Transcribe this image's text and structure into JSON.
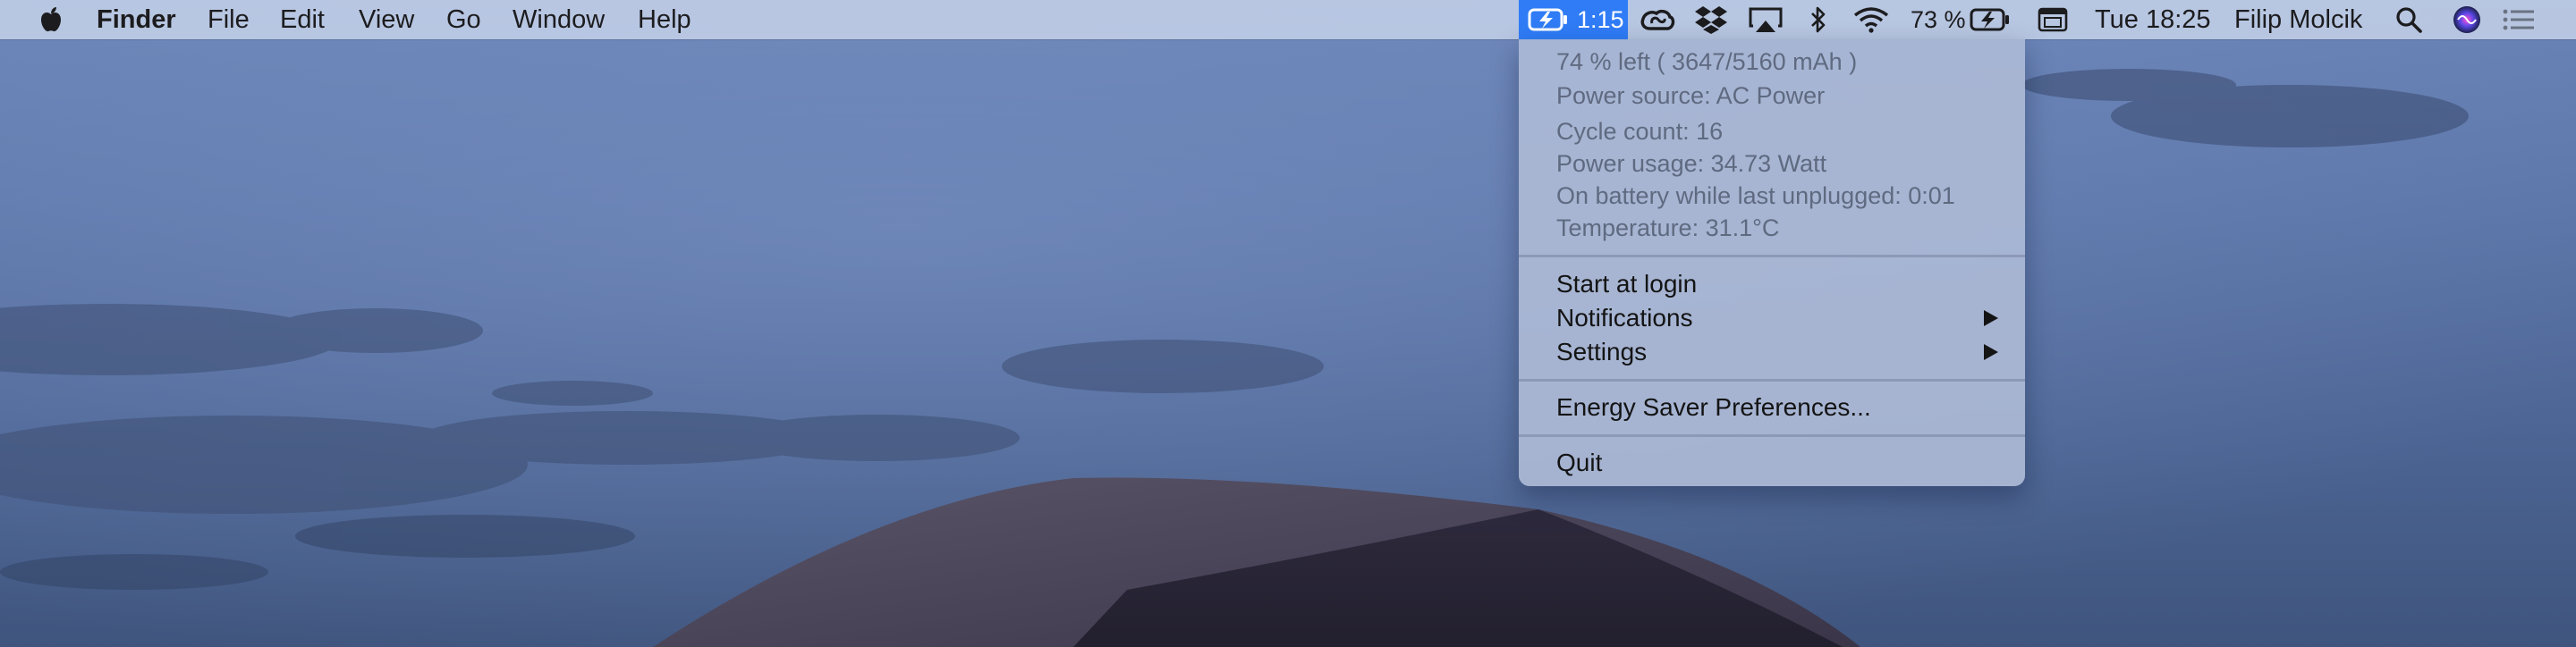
{
  "menubar": {
    "app_name": "Finder",
    "menus": [
      "File",
      "Edit",
      "View",
      "Go",
      "Window",
      "Help"
    ],
    "battery_app_time": "1:15",
    "battery_percent": "73 %",
    "datetime": "Tue 18:25",
    "user_name": "Filip Molcik",
    "icons": [
      "apple-icon",
      "battery-charging-icon",
      "creative-cloud-icon",
      "dropbox-icon",
      "airplay-icon",
      "bluetooth-icon",
      "wifi-icon",
      "battery-icon",
      "input-source-icon",
      "spotlight-search-icon",
      "siri-icon",
      "notification-center-icon"
    ]
  },
  "battery_menu": {
    "info": [
      "74 % left ( 3647/5160 mAh )",
      "Power source: AC Power",
      "Cycle count: 16",
      "Power usage: 34.73 Watt",
      "On battery while last unplugged: 0:01",
      "Temperature: 31.1°C"
    ],
    "items": [
      {
        "label": "Start at login"
      },
      {
        "label": "Notifications"
      },
      {
        "label": "Settings"
      },
      {
        "label": "Energy Saver Preferences..."
      },
      {
        "label": "Quit"
      }
    ]
  },
  "colors": {
    "menubar": "#c4d0e8",
    "highlight": "#2f7cf6",
    "menu_bg": "#acbad6",
    "info_text": "#5f6a80",
    "menu_text": "#141414"
  }
}
